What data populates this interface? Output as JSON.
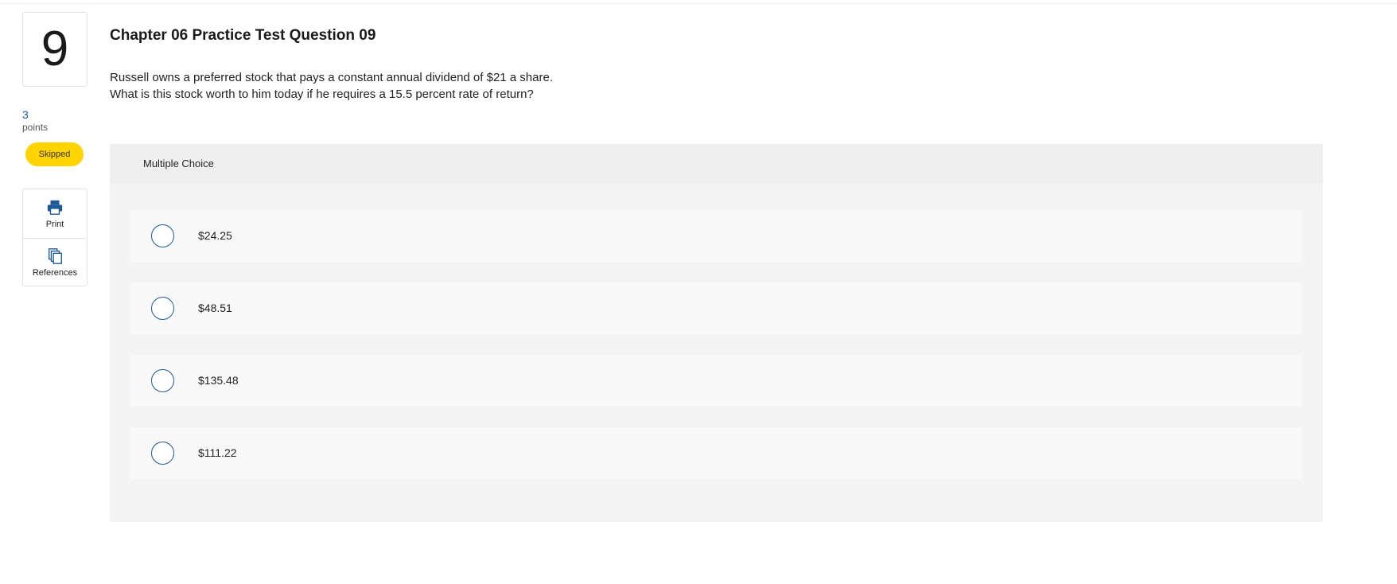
{
  "question": {
    "number": "9",
    "points_value": "3",
    "points_label": "points",
    "status": "Skipped",
    "title": "Chapter 06 Practice Test Question 09",
    "prompt_line1": "Russell owns a preferred stock that pays a constant annual dividend of $21 a share.",
    "prompt_line2": "What is this stock worth to him today if he requires a 15.5 percent rate of return?"
  },
  "tools": {
    "print_label": "Print",
    "references_label": "References"
  },
  "answer_panel": {
    "type_label": "Multiple Choice",
    "choices": [
      {
        "text": "$24.25"
      },
      {
        "text": "$48.51"
      },
      {
        "text": "$135.48"
      },
      {
        "text": "$111.22"
      }
    ]
  },
  "colors": {
    "accent": "#1e5a96",
    "status_badge": "#ffd400",
    "panel_bg": "#f4f4f4"
  },
  "icons": [
    "printer-icon",
    "references-icon",
    "radio-button"
  ]
}
